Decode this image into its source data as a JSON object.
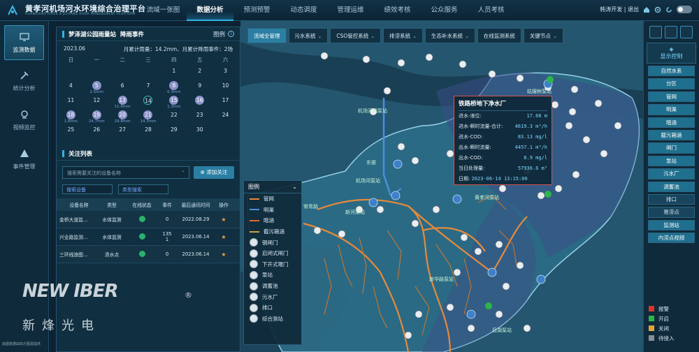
{
  "header": {
    "title": "黄孝河机场河水环境综合治理平台",
    "subtitle": "HUANGXIAO RIVER & JICHANG RIVER MANAGEMENT PLATFORM",
    "nav": [
      "流域一张图",
      "数据分析",
      "预测预警",
      "动态调度",
      "管理运维",
      "绩效考核",
      "公众服务",
      "人员考核"
    ],
    "active_nav": "数据分析",
    "user_text": "韩涛开发 | 退出"
  },
  "rail": {
    "items": [
      {
        "label": "监测数据",
        "icon": "monitor-icon",
        "active": true
      },
      {
        "label": "统计分析",
        "icon": "tools-icon",
        "active": false
      },
      {
        "label": "视频监控",
        "icon": "camera-icon",
        "active": false
      },
      {
        "label": "事件管理",
        "icon": "warning-icon",
        "active": false
      }
    ]
  },
  "rain": {
    "station": "梦泽湖公园雨量站",
    "tab": "降雨事件",
    "legend_label": "图例",
    "month": "2023.06",
    "stat": "月累计雨量：14.2mm、月累计降雨事件：2场",
    "weekdays": [
      "日",
      "一",
      "二",
      "三",
      "四",
      "五",
      "六"
    ],
    "days": [
      {
        "d": "",
        "mm": "",
        "rain": false
      },
      {
        "d": "",
        "mm": "",
        "rain": false
      },
      {
        "d": "",
        "mm": "",
        "rain": false
      },
      {
        "d": "",
        "mm": "",
        "rain": false
      },
      {
        "d": "1",
        "mm": "",
        "rain": false
      },
      {
        "d": "2",
        "mm": "",
        "rain": false
      },
      {
        "d": "3",
        "mm": "",
        "rain": false
      },
      {
        "d": "4",
        "mm": "",
        "rain": false
      },
      {
        "d": "5",
        "mm": "2.5mm",
        "rain": true
      },
      {
        "d": "6",
        "mm": "",
        "rain": false
      },
      {
        "d": "7",
        "mm": "",
        "rain": false
      },
      {
        "d": "8",
        "mm": "0.3mm",
        "rain": true
      },
      {
        "d": "9",
        "mm": "",
        "rain": false
      },
      {
        "d": "10",
        "mm": "",
        "rain": false
      },
      {
        "d": "11",
        "mm": "",
        "rain": false
      },
      {
        "d": "12",
        "mm": "",
        "rain": false
      },
      {
        "d": "13",
        "mm": "11.4mm",
        "rain": true
      },
      {
        "d": "14",
        "mm": "",
        "rain": false,
        "today": true
      },
      {
        "d": "15",
        "mm": "1.3mm",
        "rain": true
      },
      {
        "d": "16",
        "mm": "",
        "rain": true
      },
      {
        "d": "17",
        "mm": "",
        "rain": false
      },
      {
        "d": "18",
        "mm": "1.8mm",
        "rain": true
      },
      {
        "d": "19",
        "mm": "24.7mm",
        "rain": true
      },
      {
        "d": "20",
        "mm": "29.8mm",
        "rain": true
      },
      {
        "d": "21",
        "mm": "14.3mm",
        "rain": true
      },
      {
        "d": "22",
        "mm": "",
        "rain": false
      },
      {
        "d": "23",
        "mm": "",
        "rain": false
      },
      {
        "d": "24",
        "mm": "",
        "rain": false
      },
      {
        "d": "25",
        "mm": "",
        "rain": false
      },
      {
        "d": "26",
        "mm": "",
        "rain": false
      },
      {
        "d": "27",
        "mm": "",
        "rain": false
      },
      {
        "d": "28",
        "mm": "",
        "rain": false
      },
      {
        "d": "29",
        "mm": "",
        "rain": false
      },
      {
        "d": "30",
        "mm": "",
        "rain": false
      },
      {
        "d": "",
        "mm": "",
        "rain": false
      }
    ]
  },
  "focus": {
    "title": "关注列表",
    "search_placeholder": "搜索需要关注的设备名称",
    "add_label": "添加关注",
    "filter_device": "搜索设备",
    "filter_type": "类型搜索",
    "columns": [
      "设备名称",
      "类型",
      "在线状态",
      "事件",
      "最后通讯时间",
      "操作"
    ],
    "rows": [
      {
        "name": "金桥大道监…",
        "type": "水体监测",
        "event": "0",
        "time": "2022.08.29"
      },
      {
        "name": "兴业路监测…",
        "type": "水体监测",
        "event": "135\n1",
        "time": "2023.06.14"
      },
      {
        "name": "三环线浪图…",
        "type": "渍水点",
        "event": "0",
        "time": "2023.06.14"
      }
    ]
  },
  "watermark": {
    "brand": "NEW IBER",
    "cn": "新烽光电",
    "reg": "®"
  },
  "credit": "底图数据由四方图源提供",
  "map_tabs": [
    {
      "label": "流域全管理",
      "active": true,
      "chev": false
    },
    {
      "label": "污水系统",
      "active": false,
      "chev": true
    },
    {
      "label": "CSO管控系统",
      "active": false,
      "chev": true
    },
    {
      "label": "排涝系统",
      "active": false,
      "chev": true
    },
    {
      "label": "生态补水系统",
      "active": false,
      "chev": true
    },
    {
      "label": "在线监测系统",
      "active": false,
      "chev": false
    },
    {
      "label": "关键节点",
      "active": false,
      "chev": true
    }
  ],
  "map_labels": [
    "机场河闸泵站",
    "机场河泵站",
    "常青路",
    "新河泵站",
    "黄孝河泵站",
    "姑嫂树泵站",
    "后湖泵站",
    "新华路泵站",
    "铁路桥地下净水厂",
    "东渠"
  ],
  "popup": {
    "title": "铁路桥地下净水厂",
    "rows": [
      {
        "label": "进水-液位:",
        "value": "17.66 m"
      },
      {
        "label": "进水-瞬时流量-合计:",
        "value": "4619.3 m³/h"
      },
      {
        "label": "进水-COD:",
        "value": "83.13 mg/l"
      },
      {
        "label": "出水-瞬时流量:",
        "value": "4457.1 m³/h"
      },
      {
        "label": "出水-COD:",
        "value": "8.9 mg/l"
      },
      {
        "label": "当日处理量:",
        "value": "57936.6 m³"
      }
    ],
    "time_label": "日期:",
    "time": "2023-06-14 13:15:00"
  },
  "legend": {
    "title": "图例",
    "items": [
      {
        "label": "管网",
        "kind": "line",
        "color": "#e58a3c"
      },
      {
        "label": "明渠",
        "kind": "line",
        "color": "#4a8ee0"
      },
      {
        "label": "暗涵",
        "kind": "line",
        "color": "#e06a2e"
      },
      {
        "label": "截污箱涵",
        "kind": "line",
        "color": "#c9a24a"
      },
      {
        "label": "钢闸门",
        "kind": "icon"
      },
      {
        "label": "启闭式闸门",
        "kind": "icon"
      },
      {
        "label": "下开式堰门",
        "kind": "icon"
      },
      {
        "label": "泵站",
        "kind": "icon"
      },
      {
        "label": "调蓄池",
        "kind": "icon"
      },
      {
        "label": "污水厂",
        "kind": "icon"
      },
      {
        "label": "排口",
        "kind": "icon"
      },
      {
        "label": "综合测站",
        "kind": "icon"
      }
    ]
  },
  "right": {
    "control_title": "显示控制",
    "buttons": [
      {
        "label": "自然水系",
        "on": true
      },
      {
        "label": "分区",
        "on": true
      },
      {
        "label": "管网",
        "on": true
      },
      {
        "label": "明渠",
        "on": true
      },
      {
        "label": "暗涵",
        "on": true
      },
      {
        "label": "截污箱涵",
        "on": true
      },
      {
        "label": "闸门",
        "on": true
      },
      {
        "label": "泵站",
        "on": true
      },
      {
        "label": "污水厂",
        "on": true
      },
      {
        "label": "调蓄池",
        "on": true
      },
      {
        "label": "排口",
        "on": false
      },
      {
        "label": "易涝点",
        "on": false
      },
      {
        "label": "监测站",
        "on": true
      },
      {
        "label": "内涝点视频",
        "on": true
      }
    ],
    "status": [
      {
        "label": "报警",
        "color": "#d9362f"
      },
      {
        "label": "开启",
        "color": "#2cb54a"
      },
      {
        "label": "关闭",
        "color": "#e1a43a"
      },
      {
        "label": "待接入",
        "color": "#8a8f94"
      }
    ]
  }
}
